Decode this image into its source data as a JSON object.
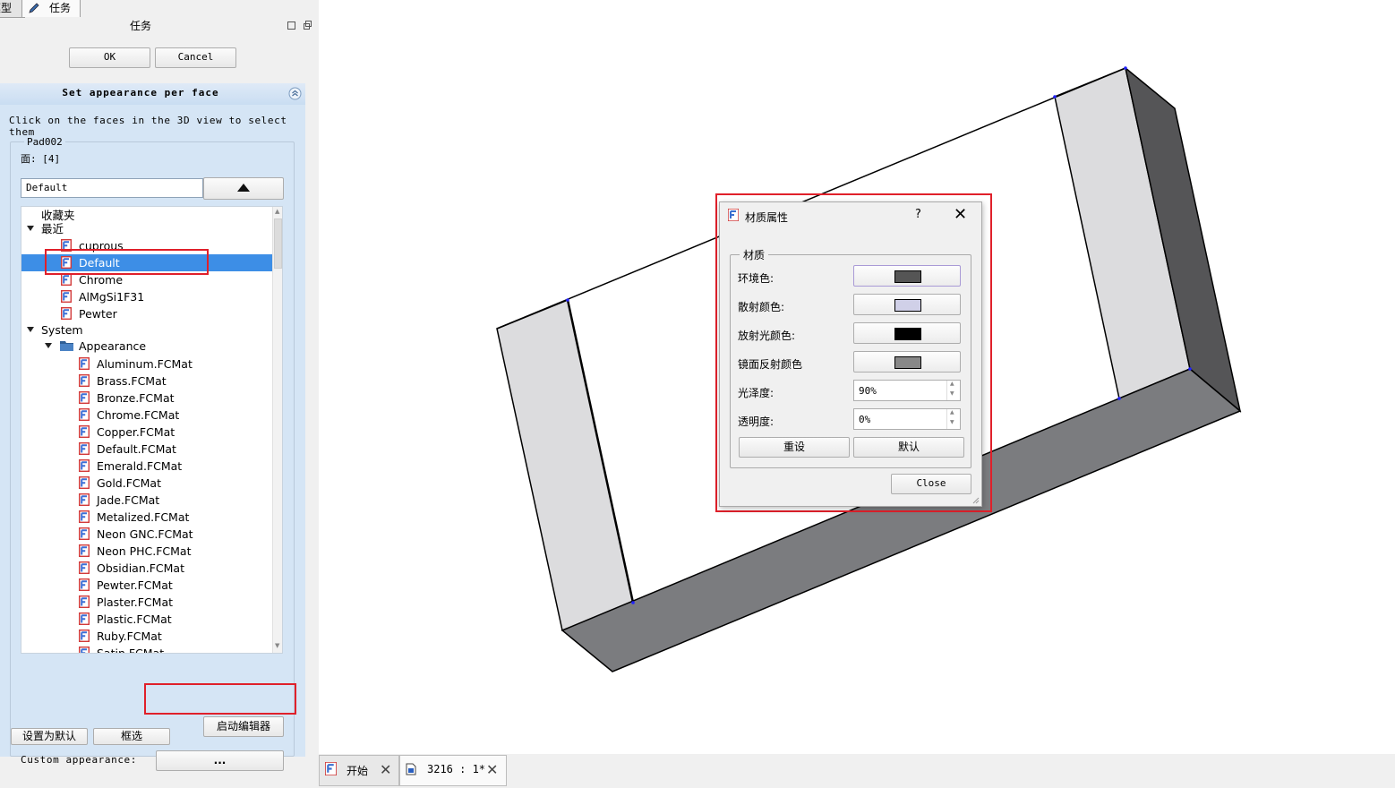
{
  "tabs": {
    "model_label": "模型",
    "task_label": "任务"
  },
  "panel": {
    "title": "任务",
    "ok_label": "OK",
    "cancel_label": "Cancel"
  },
  "taskbox": {
    "title": "Set appearance per face",
    "instruction": "Click on the faces in the 3D view to select them",
    "object_name": "Pad002",
    "face_info": "面: [4]",
    "combo_value": "Default",
    "launch_editor_label": "启动编辑器",
    "custom_appearance_label": "Custom appearance:",
    "custom_button_label": "...",
    "set_default_label": "设置为默认",
    "box_select_label": "框选"
  },
  "tree": {
    "favorites": "收藏夹",
    "recent": "最近",
    "recent_items": [
      "cuprous",
      "Default",
      "Chrome",
      "AlMgSi1F31",
      "Pewter"
    ],
    "selected": "Default",
    "system": "System",
    "appearance_folder": "Appearance",
    "system_items": [
      "Aluminum.FCMat",
      "Brass.FCMat",
      "Bronze.FCMat",
      "Chrome.FCMat",
      "Copper.FCMat",
      "Default.FCMat",
      "Emerald.FCMat",
      "Gold.FCMat",
      "Jade.FCMat",
      "Metalized.FCMat",
      "Neon GNC.FCMat",
      "Neon PHC.FCMat",
      "Obsidian.FCMat",
      "Pewter.FCMat",
      "Plaster.FCMat",
      "Plastic.FCMat",
      "Ruby.FCMat",
      "Satin.FCMat"
    ]
  },
  "dialog": {
    "title": "材质属性",
    "help": "?",
    "close_glyph": "✕",
    "group_title": "材质",
    "ambient_label": "环境色:",
    "diffuse_label": "散射颜色:",
    "emissive_label": "放射光颜色:",
    "specular_label": "镜面反射颜色",
    "shininess_label": "光泽度:",
    "shininess_value": "90%",
    "transparency_label": "透明度:",
    "transparency_value": "0%",
    "reset_label": "重设",
    "default_label": "默认",
    "close_label": "Close",
    "colors": {
      "ambient": "#555555",
      "diffuse": "#d0d0e8",
      "emissive": "#000000",
      "specular": "#888888"
    }
  },
  "doc_tabs": {
    "start_label": "开始",
    "doc_label": "3216 : 1*",
    "close_glyph": "✕"
  },
  "colors": {
    "accent": "#3d8ee6",
    "highlight": "#e0202a",
    "taskbox_bg": "#d5e5f5"
  }
}
